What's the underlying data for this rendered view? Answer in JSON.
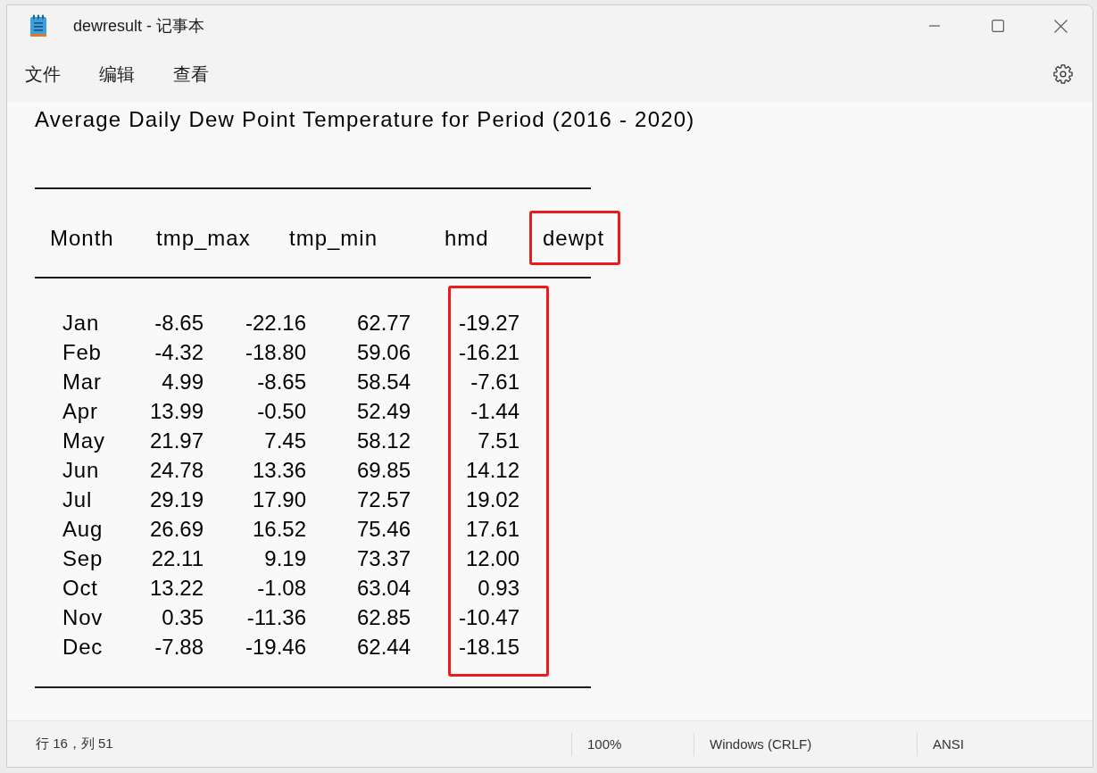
{
  "window": {
    "title": "dewresult - 记事本"
  },
  "menu_bar": {
    "items": [
      "文件",
      "编辑",
      "查看"
    ]
  },
  "document": {
    "heading": "Average Daily Dew Point Temperature for Period (2016 - 2020)",
    "columns": [
      {
        "label": "Month",
        "highlighted": false
      },
      {
        "label": "tmp_max",
        "highlighted": false
      },
      {
        "label": "tmp_min",
        "highlighted": false
      },
      {
        "label": "hmd",
        "highlighted": false
      },
      {
        "label": "dewpt",
        "highlighted": true
      }
    ],
    "rows": [
      [
        "Jan",
        "-8.65",
        "-22.16",
        "62.77",
        "-19.27"
      ],
      [
        "Feb",
        "-4.32",
        "-18.80",
        "59.06",
        "-16.21"
      ],
      [
        "Mar",
        "4.99",
        "-8.65",
        "58.54",
        "-7.61"
      ],
      [
        "Apr",
        "13.99",
        "-0.50",
        "52.49",
        "-1.44"
      ],
      [
        "May",
        "21.97",
        "7.45",
        "58.12",
        "7.51"
      ],
      [
        "Jun",
        "24.78",
        "13.36",
        "69.85",
        "14.12"
      ],
      [
        "Jul",
        "29.19",
        "17.90",
        "72.57",
        "19.02"
      ],
      [
        "Aug",
        "26.69",
        "16.52",
        "75.46",
        "17.61"
      ],
      [
        "Sep",
        "22.11",
        "9.19",
        "73.37",
        "12.00"
      ],
      [
        "Oct",
        "13.22",
        "-1.08",
        "63.04",
        "0.93"
      ],
      [
        "Nov",
        "0.35",
        "-11.36",
        "62.85",
        "-10.47"
      ],
      [
        "Dec",
        "-7.88",
        "-19.46",
        "62.44",
        "-18.15"
      ]
    ]
  },
  "status_bar": {
    "position": "行 16，列 51",
    "zoom": "100%",
    "line_ending": "Windows (CRLF)",
    "encoding": "ANSI"
  }
}
